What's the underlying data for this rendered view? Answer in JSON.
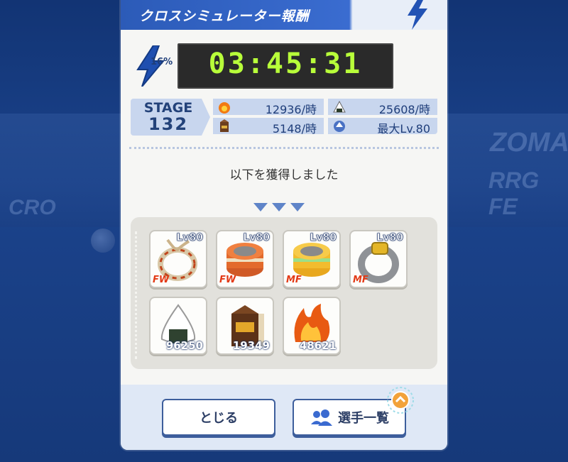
{
  "background": {
    "text_1": "ZOMA",
    "text_2": "RRG FE",
    "text_3": "CRO"
  },
  "panel": {
    "title": "クロスシミュレーター報酬"
  },
  "energy": {
    "percent": "16%"
  },
  "timer": {
    "value": "03:45:31"
  },
  "stage": {
    "label": "STAGE",
    "number": "132"
  },
  "stats": {
    "fire_rate": "12936/時",
    "riceball_rate": "25608/時",
    "milk_rate": "5148/時",
    "max_level": "最大Lv.80"
  },
  "message": "以下を獲得しました",
  "rewards": [
    {
      "name": "rope-ring",
      "level": "Lv80",
      "position": "FW"
    },
    {
      "name": "orange-wristband",
      "level": "Lv80",
      "position": "FW"
    },
    {
      "name": "yellow-wristband",
      "level": "Lv80",
      "position": "MF"
    },
    {
      "name": "gold-ring",
      "level": "Lv80",
      "position": "MF"
    },
    {
      "name": "rice-ball",
      "quantity": "96250"
    },
    {
      "name": "milk-carton",
      "quantity": "19349"
    },
    {
      "name": "fire-spirit",
      "quantity": "48621"
    }
  ],
  "buttons": {
    "close": "とじる",
    "player_list": "選手一覧"
  },
  "colors": {
    "accent": "#2c5bb8",
    "timer_text": "#b8ff3a",
    "position_badge": "#e33a16"
  }
}
